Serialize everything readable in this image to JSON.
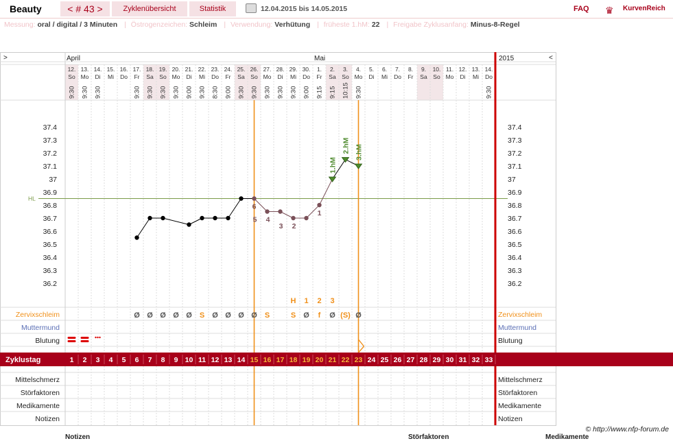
{
  "header": {
    "title": "Beauty",
    "cycle": "< # 43 >",
    "tab_overview": "Zyklenübersicht",
    "tab_stats": "Statistik",
    "daterange": "12.04.2015 bis 14.05.2015",
    "faq": "FAQ",
    "brand": "KurvenReich"
  },
  "info": {
    "messung_label": "Messung:",
    "messung": "oral / digital / 3 Minuten",
    "oestro_label": "Östrogenzeichen:",
    "oestro": "Schleim",
    "verwendung_label": "Verwendung:",
    "verwendung": "Verhütung",
    "hm_label": "früheste 1.hM:",
    "hm": "22",
    "freigabe_label": "Freigabe Zyklusanfang:",
    "freigabe": "Minus-8-Regel"
  },
  "nav": {
    "left": ">",
    "right": "<",
    "year": "2015"
  },
  "months": [
    {
      "label": "April",
      "index": 0
    },
    {
      "label": "Mai",
      "index": 19
    }
  ],
  "dates": [
    "12.",
    "13.",
    "14.",
    "15.",
    "16.",
    "17.",
    "18.",
    "19.",
    "20.",
    "21.",
    "22.",
    "23.",
    "24.",
    "25.",
    "26.",
    "27.",
    "28.",
    "29.",
    "30.",
    "1.",
    "2.",
    "3.",
    "4.",
    "5.",
    "6.",
    "7.",
    "8.",
    "9.",
    "10.",
    "11.",
    "12.",
    "13.",
    "14."
  ],
  "weekdays": [
    "So",
    "Mo",
    "Di",
    "Mi",
    "Do",
    "Fr",
    "Sa",
    "So",
    "Mo",
    "Di",
    "Mi",
    "Do",
    "Fr",
    "Sa",
    "So",
    "Mo",
    "Di",
    "Mi",
    "Do",
    "Fr",
    "Sa",
    "So",
    "Mo",
    "Di",
    "Mi",
    "Do",
    "Fr",
    "Sa",
    "So",
    "Mo",
    "Di",
    "Mi",
    "Do"
  ],
  "times": [
    "9:30",
    "9:30",
    "9:30",
    "",
    "",
    "9:30",
    "9:30",
    "9:30",
    "9:30",
    "9:00",
    "9:30",
    "8:30",
    "9:00",
    "9:30",
    "9:30",
    "9:30",
    "9:30",
    "9:30",
    "9:00",
    "9:15",
    "9:15",
    "10:15",
    "9:30",
    "",
    "",
    "",
    "",
    "",
    "",
    "",
    "",
    "",
    "9:30"
  ],
  "weekend_days": [
    0,
    6,
    7,
    13,
    14,
    20,
    21,
    27,
    28
  ],
  "chart_data": {
    "type": "line",
    "x": [
      6,
      7,
      8,
      10,
      11,
      12,
      13,
      14,
      15,
      16,
      17,
      18,
      19,
      20,
      21,
      22,
      23
    ],
    "values": [
      36.55,
      36.7,
      36.7,
      36.65,
      36.7,
      36.7,
      36.7,
      36.85,
      36.85,
      36.75,
      36.75,
      36.7,
      36.7,
      36.8,
      37.0,
      37.15,
      37.1
    ],
    "ylim": [
      36.2,
      37.4
    ],
    "yticks": [
      "37.4",
      "37.3",
      "37.2",
      "37.1",
      "37",
      "36.9",
      "36.8",
      "36.7",
      "36.6",
      "36.5",
      "36.4",
      "36.3",
      "36.2"
    ],
    "hl_value": 36.85,
    "hl_label": "HL",
    "low_labels": [
      {
        "day": 15,
        "text": "6"
      },
      {
        "day": 16,
        "text": "5"
      },
      {
        "day": 17,
        "text": "4"
      },
      {
        "day": 18,
        "text": "3"
      },
      {
        "day": 19,
        "text": "2"
      },
      {
        "day": 20,
        "text": "1"
      }
    ],
    "high_labels": [
      {
        "day": 21,
        "text": "1.hM"
      },
      {
        "day": 22,
        "text": "2.hM"
      },
      {
        "day": 23,
        "text": "3.hM"
      }
    ],
    "vlines": [
      14.5,
      22.5
    ]
  },
  "rows": {
    "zervix": "Zervixschleim",
    "muttermund": "Muttermund",
    "blutung": "Blutung",
    "zyklustag": "Zyklustag",
    "mittelschmerz": "Mittelschmerz",
    "stoerfaktoren": "Störfaktoren",
    "medikamente": "Medikamente",
    "notizen": "Notizen"
  },
  "zervix_marks": {
    "6": "Ø",
    "7": "Ø",
    "8": "Ø",
    "9": "Ø",
    "10": "Ø",
    "11": "S",
    "12": "Ø",
    "13": "Ø",
    "14": "Ø",
    "15": "Ø",
    "16": "S",
    "18": "S",
    "19": "Ø",
    "20": "f",
    "21": "Ø",
    "22": "(S)",
    "23": "Ø"
  },
  "zervix_top": {
    "18": "H",
    "19": "1",
    "20": "2",
    "21": "3"
  },
  "cycle_days": [
    "1",
    "2",
    "3",
    "4",
    "5",
    "6",
    "7",
    "8",
    "9",
    "10",
    "11",
    "12",
    "13",
    "14",
    "15",
    "16",
    "17",
    "18",
    "19",
    "20",
    "21",
    "22",
    "23",
    "24",
    "25",
    "26",
    "27",
    "28",
    "29",
    "30",
    "31",
    "32",
    "33"
  ],
  "footer": "© http://www.nfp-forum.de",
  "bottom": {
    "notizen": "Notizen",
    "stoer": "Störfaktoren",
    "medi": "Medikamente"
  }
}
